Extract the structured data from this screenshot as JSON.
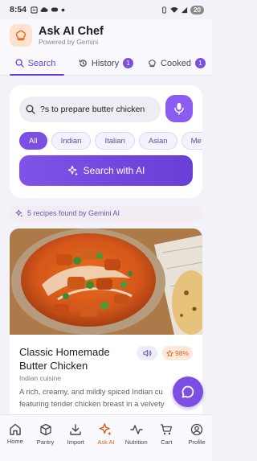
{
  "status_bar": {
    "time": "8:54",
    "battery": "20"
  },
  "header": {
    "title": "Ask AI Chef",
    "subtitle": "Powered by Gemini"
  },
  "tabs": [
    {
      "label": "Search",
      "badge": ""
    },
    {
      "label": "History",
      "badge": "1"
    },
    {
      "label": "Cooked",
      "badge": "1"
    }
  ],
  "search": {
    "query": "How to prepare butter chicken?",
    "visible_text": "s to prepare butter chicken?",
    "chips": [
      "All",
      "Indian",
      "Italian",
      "Asian",
      "Me"
    ],
    "selected_chip": "All",
    "button_label": "Search with AI"
  },
  "results": {
    "banner": "5 recipes found by Gemini AI"
  },
  "recipe": {
    "title": "Classic Homemade Butter Chicken",
    "cuisine": "Indian cuisine",
    "match": "98%",
    "description": "A rich, creamy, and mildly spiced Indian cu featuring tender chicken breast in a velvety"
  },
  "bottom_nav": [
    {
      "label": "Home",
      "icon": "home-icon"
    },
    {
      "label": "Pantry",
      "icon": "box-icon"
    },
    {
      "label": "Import",
      "icon": "download-icon"
    },
    {
      "label": "Ask AI",
      "icon": "sparkle-icon"
    },
    {
      "label": "Nutrition",
      "icon": "pulse-icon"
    },
    {
      "label": "Cart",
      "icon": "cart-icon"
    },
    {
      "label": "Profile",
      "icon": "profile-icon"
    }
  ],
  "colors": {
    "accent": "#7b4ee4",
    "active_nav": "#d9661e",
    "match_badge": "#fde9dc"
  }
}
